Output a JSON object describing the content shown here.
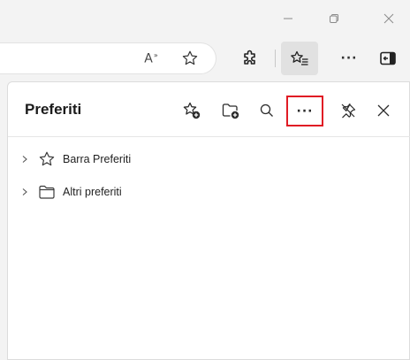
{
  "window": {
    "controls": {
      "minimize_icon": "minimize-icon",
      "maximize_icon": "maximize-icon",
      "close_icon": "close-icon"
    }
  },
  "toolbar": {
    "read_aloud_glyph": "A",
    "read_aloud_sup": "»",
    "more_label": "···",
    "icons": [
      "read-aloud-icon",
      "add-favorite-star-icon",
      "extensions-puzzle-icon",
      "favorites-list-icon",
      "more-dots-icon",
      "sidebar-toggle-icon"
    ]
  },
  "favorites_panel": {
    "title": "Preferiti",
    "more_label": "···",
    "highlight_color": "#e01b24",
    "actions": [
      "add-current-page-icon",
      "add-folder-icon",
      "search-icon",
      "more-options-icon",
      "unpin-icon",
      "close-icon"
    ],
    "items": [
      {
        "label": "Barra Preferiti",
        "icon": "star-icon"
      },
      {
        "label": "Altri preferiti",
        "icon": "folder-icon"
      }
    ]
  }
}
